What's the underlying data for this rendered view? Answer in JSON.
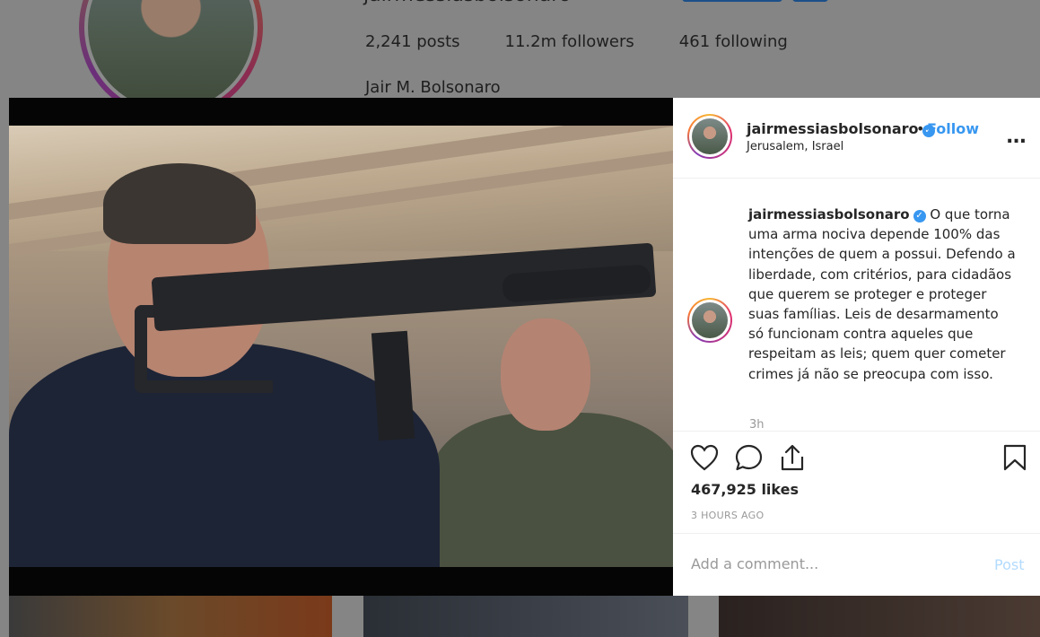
{
  "profile": {
    "username_top": "jairmessiasbolsonaro",
    "posts": "2,241 posts",
    "followers": "11.2m followers",
    "following": "461 following",
    "full_name": "Jair M. Bolsonaro"
  },
  "post": {
    "header": {
      "username": "jairmessiasbolsonaro",
      "verified_icon": "verified-badge-icon",
      "separator": "•",
      "follow_label": "Follow",
      "location": "Jerusalem, Israel",
      "more_label": "..."
    },
    "caption": {
      "username": "jairmessiasbolsonaro",
      "text": "O que torna uma arma nociva depende 100% das intenções de quem a possui. Defendo a liberdade, com critérios, para cidadãos que querem se proteger e proteger suas famílias. Leis de desarmamento só funcionam contra aqueles que respeitam as leis; quem quer cometer crimes já não se preocupa com isso.",
      "time": "3h"
    },
    "likes": "467,925 likes",
    "time_ago": "3 HOURS AGO",
    "comment_placeholder": "Add a comment...",
    "post_label": "Post"
  },
  "colors": {
    "accent": "#3897f0",
    "text": "#262626",
    "muted": "#999999"
  }
}
